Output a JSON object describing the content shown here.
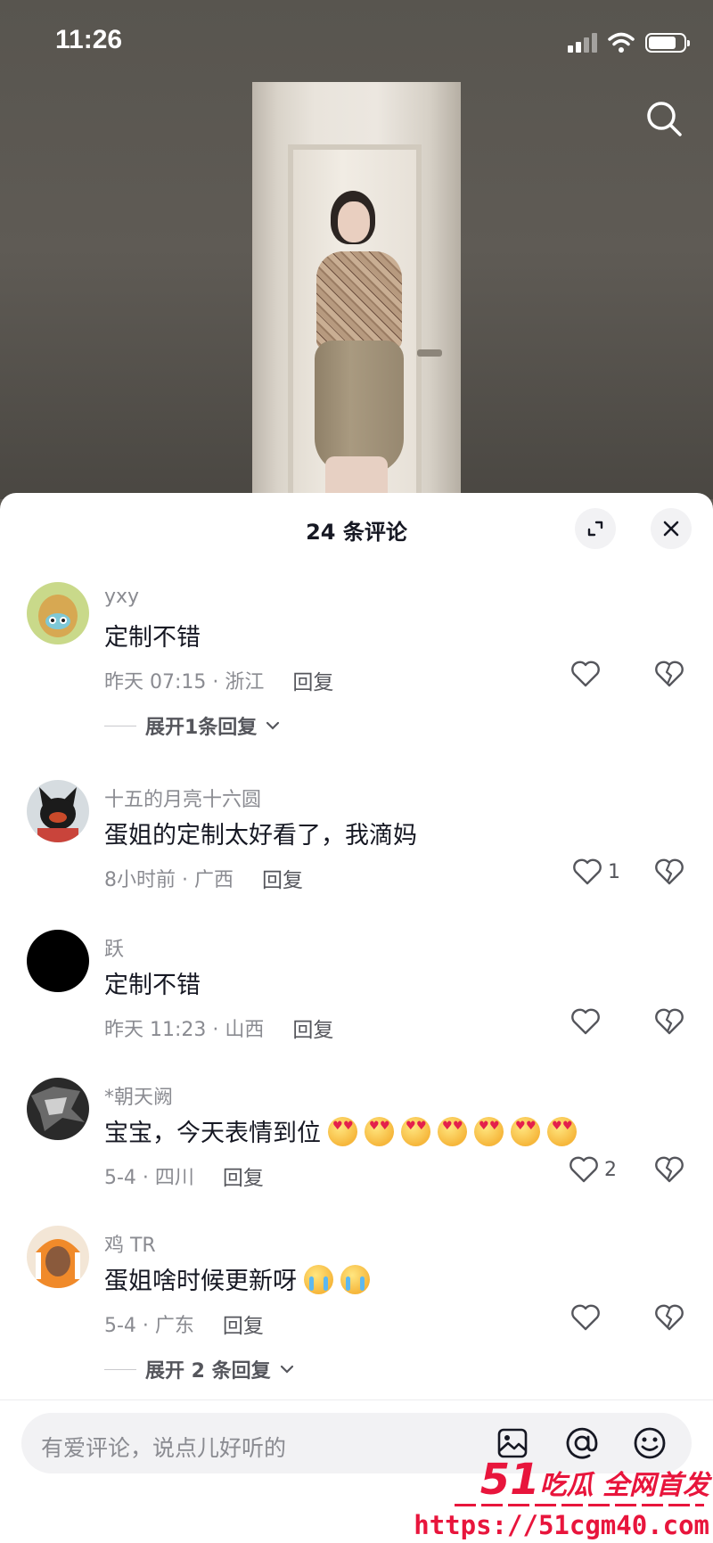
{
  "status_bar": {
    "time": "11:26"
  },
  "sheet": {
    "title": "24 条评论"
  },
  "comments": [
    {
      "name": "yxy",
      "text": "定制不错",
      "time": "昨天 07:15 · 浙江",
      "reply": "回复",
      "likes": "",
      "expand": "展开1条回复"
    },
    {
      "name": "十五的月亮十六圆",
      "text": "蛋姐的定制太好看了，我滴妈",
      "time": "8小时前 · 广西",
      "reply": "回复",
      "likes": "1"
    },
    {
      "name": "跃",
      "text": "定制不错",
      "time": "昨天 11:23 · 山西",
      "reply": "回复",
      "likes": ""
    },
    {
      "name": "*朝天阙",
      "text": "宝宝，今天表情到位",
      "time": "5-4 · 四川",
      "reply": "回复",
      "likes": "2"
    },
    {
      "name": "鸡 TR",
      "text": "蛋姐啥时候更新呀",
      "time": "5-4 · 广东",
      "reply": "回复",
      "likes": "",
      "expand": "展开 2 条回复"
    }
  ],
  "input": {
    "placeholder": "有爱评论，说点儿好听的"
  },
  "watermark": {
    "brand_num": "51",
    "brand_text": "吃瓜 全网首发",
    "url": "https://51cgm40.com"
  },
  "colors": {
    "accent_red": "#e8153c",
    "text_primary": "#161823",
    "text_secondary": "#8a8b91"
  },
  "icons": [
    "search-icon",
    "expand-icon",
    "close-icon",
    "heart-icon",
    "broken-heart-icon",
    "image-icon",
    "at-icon",
    "emoji-icon",
    "chevron-down-icon"
  ]
}
